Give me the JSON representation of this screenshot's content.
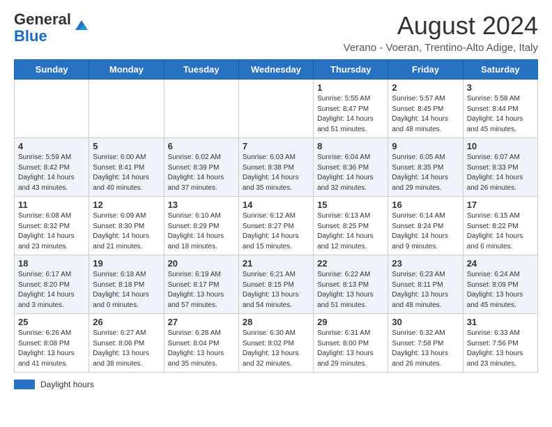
{
  "header": {
    "logo_general": "General",
    "logo_blue": "Blue",
    "month_year": "August 2024",
    "location": "Verano - Voeran, Trentino-Alto Adige, Italy"
  },
  "weekdays": [
    "Sunday",
    "Monday",
    "Tuesday",
    "Wednesday",
    "Thursday",
    "Friday",
    "Saturday"
  ],
  "weeks": [
    [
      {
        "day": "",
        "info": ""
      },
      {
        "day": "",
        "info": ""
      },
      {
        "day": "",
        "info": ""
      },
      {
        "day": "",
        "info": ""
      },
      {
        "day": "1",
        "info": "Sunrise: 5:55 AM\nSunset: 8:47 PM\nDaylight: 14 hours and 51 minutes."
      },
      {
        "day": "2",
        "info": "Sunrise: 5:57 AM\nSunset: 8:45 PM\nDaylight: 14 hours and 48 minutes."
      },
      {
        "day": "3",
        "info": "Sunrise: 5:58 AM\nSunset: 8:44 PM\nDaylight: 14 hours and 45 minutes."
      }
    ],
    [
      {
        "day": "4",
        "info": "Sunrise: 5:59 AM\nSunset: 8:42 PM\nDaylight: 14 hours and 43 minutes."
      },
      {
        "day": "5",
        "info": "Sunrise: 6:00 AM\nSunset: 8:41 PM\nDaylight: 14 hours and 40 minutes."
      },
      {
        "day": "6",
        "info": "Sunrise: 6:02 AM\nSunset: 8:39 PM\nDaylight: 14 hours and 37 minutes."
      },
      {
        "day": "7",
        "info": "Sunrise: 6:03 AM\nSunset: 8:38 PM\nDaylight: 14 hours and 35 minutes."
      },
      {
        "day": "8",
        "info": "Sunrise: 6:04 AM\nSunset: 8:36 PM\nDaylight: 14 hours and 32 minutes."
      },
      {
        "day": "9",
        "info": "Sunrise: 6:05 AM\nSunset: 8:35 PM\nDaylight: 14 hours and 29 minutes."
      },
      {
        "day": "10",
        "info": "Sunrise: 6:07 AM\nSunset: 8:33 PM\nDaylight: 14 hours and 26 minutes."
      }
    ],
    [
      {
        "day": "11",
        "info": "Sunrise: 6:08 AM\nSunset: 8:32 PM\nDaylight: 14 hours and 23 minutes."
      },
      {
        "day": "12",
        "info": "Sunrise: 6:09 AM\nSunset: 8:30 PM\nDaylight: 14 hours and 21 minutes."
      },
      {
        "day": "13",
        "info": "Sunrise: 6:10 AM\nSunset: 8:29 PM\nDaylight: 14 hours and 18 minutes."
      },
      {
        "day": "14",
        "info": "Sunrise: 6:12 AM\nSunset: 8:27 PM\nDaylight: 14 hours and 15 minutes."
      },
      {
        "day": "15",
        "info": "Sunrise: 6:13 AM\nSunset: 8:25 PM\nDaylight: 14 hours and 12 minutes."
      },
      {
        "day": "16",
        "info": "Sunrise: 6:14 AM\nSunset: 8:24 PM\nDaylight: 14 hours and 9 minutes."
      },
      {
        "day": "17",
        "info": "Sunrise: 6:15 AM\nSunset: 8:22 PM\nDaylight: 14 hours and 6 minutes."
      }
    ],
    [
      {
        "day": "18",
        "info": "Sunrise: 6:17 AM\nSunset: 8:20 PM\nDaylight: 14 hours and 3 minutes."
      },
      {
        "day": "19",
        "info": "Sunrise: 6:18 AM\nSunset: 8:18 PM\nDaylight: 14 hours and 0 minutes."
      },
      {
        "day": "20",
        "info": "Sunrise: 6:19 AM\nSunset: 8:17 PM\nDaylight: 13 hours and 57 minutes."
      },
      {
        "day": "21",
        "info": "Sunrise: 6:21 AM\nSunset: 8:15 PM\nDaylight: 13 hours and 54 minutes."
      },
      {
        "day": "22",
        "info": "Sunrise: 6:22 AM\nSunset: 8:13 PM\nDaylight: 13 hours and 51 minutes."
      },
      {
        "day": "23",
        "info": "Sunrise: 6:23 AM\nSunset: 8:11 PM\nDaylight: 13 hours and 48 minutes."
      },
      {
        "day": "24",
        "info": "Sunrise: 6:24 AM\nSunset: 8:09 PM\nDaylight: 13 hours and 45 minutes."
      }
    ],
    [
      {
        "day": "25",
        "info": "Sunrise: 6:26 AM\nSunset: 8:08 PM\nDaylight: 13 hours and 41 minutes."
      },
      {
        "day": "26",
        "info": "Sunrise: 6:27 AM\nSunset: 8:06 PM\nDaylight: 13 hours and 38 minutes."
      },
      {
        "day": "27",
        "info": "Sunrise: 6:28 AM\nSunset: 8:04 PM\nDaylight: 13 hours and 35 minutes."
      },
      {
        "day": "28",
        "info": "Sunrise: 6:30 AM\nSunset: 8:02 PM\nDaylight: 13 hours and 32 minutes."
      },
      {
        "day": "29",
        "info": "Sunrise: 6:31 AM\nSunset: 8:00 PM\nDaylight: 13 hours and 29 minutes."
      },
      {
        "day": "30",
        "info": "Sunrise: 6:32 AM\nSunset: 7:58 PM\nDaylight: 13 hours and 26 minutes."
      },
      {
        "day": "31",
        "info": "Sunrise: 6:33 AM\nSunset: 7:56 PM\nDaylight: 13 hours and 23 minutes."
      }
    ]
  ],
  "footer": {
    "daylight_label": "Daylight hours"
  }
}
